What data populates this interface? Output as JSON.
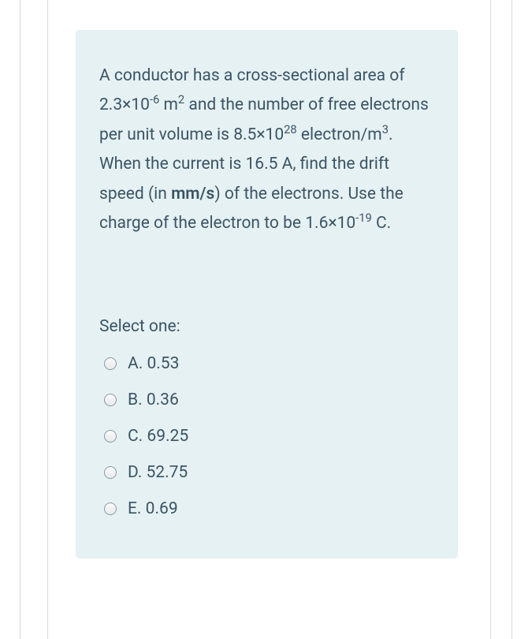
{
  "question": {
    "text": " A conductor has a cross-sectional area of  2.3×10<sup>-6</sup> m<sup>2</sup> and the number of free electrons per unit volume is 8.5×10<sup>28</sup> electron/m<sup>3</sup>. When the current is 16.5 A, find the drift speed (in <b>mm/s</b>) of the electrons. Use the charge of the electron to be 1.6×10<sup>-19</sup> C."
  },
  "select_label": "Select one:",
  "options": [
    {
      "letter": "A",
      "value": "0.53"
    },
    {
      "letter": "B",
      "value": "0.36"
    },
    {
      "letter": "C",
      "value": "69.25"
    },
    {
      "letter": "D",
      "value": "52.75"
    },
    {
      "letter": "E",
      "value": "0.69"
    }
  ]
}
